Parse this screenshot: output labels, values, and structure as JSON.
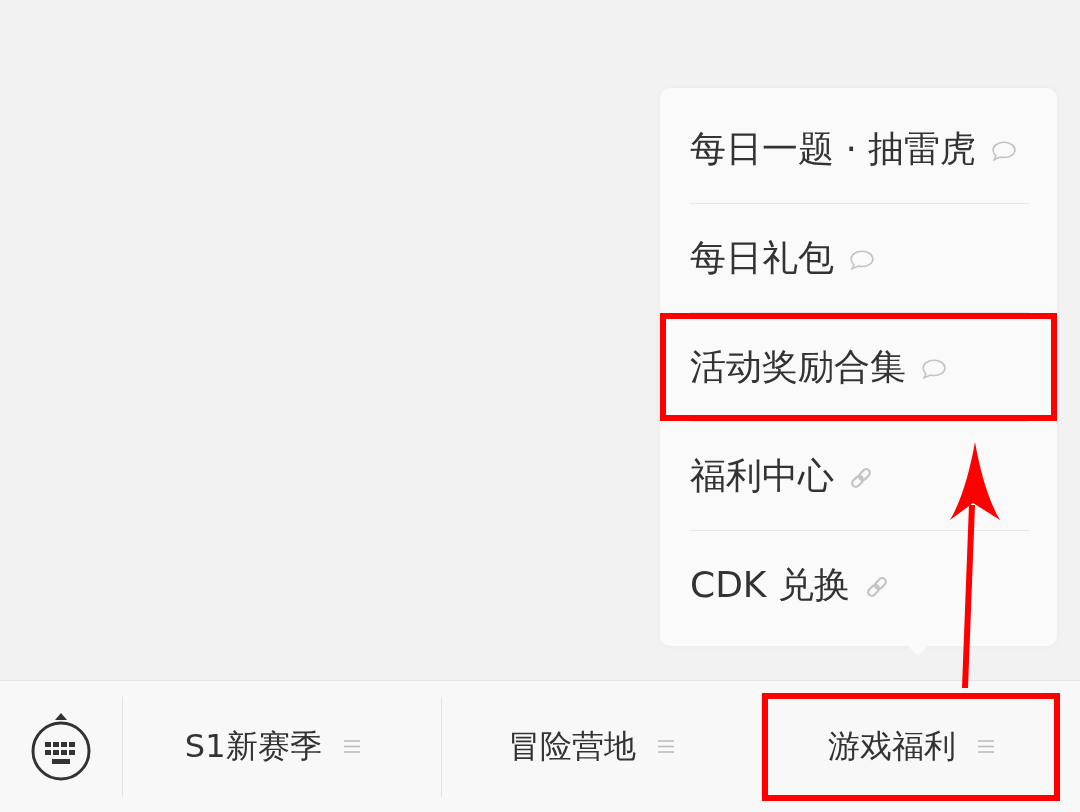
{
  "popup_menu": {
    "items": [
      {
        "label": "每日一题 · 抽雷虎",
        "kind": "comment",
        "highlighted": false
      },
      {
        "label": "每日礼包",
        "kind": "comment",
        "highlighted": false
      },
      {
        "label": "活动奖励合集",
        "kind": "comment",
        "highlighted": true
      },
      {
        "label": "福利中心",
        "kind": "link",
        "highlighted": false
      },
      {
        "label": "CDK 兑换",
        "kind": "link",
        "highlighted": false
      }
    ]
  },
  "bottom_bar": {
    "tabs": [
      {
        "label": "S1新赛季",
        "highlighted": false
      },
      {
        "label": "冒险营地",
        "highlighted": false
      },
      {
        "label": "游戏福利",
        "highlighted": true
      }
    ]
  },
  "callout_arrow": true
}
